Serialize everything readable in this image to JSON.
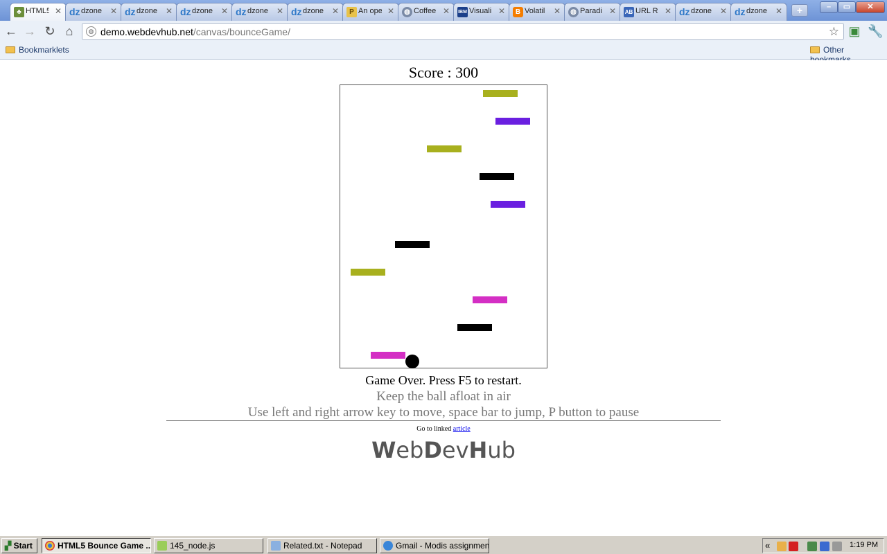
{
  "window": {
    "tabs": [
      {
        "label": "HTML5",
        "icon": "tree-icon",
        "active": true
      },
      {
        "label": "dzone",
        "icon": "dzone-icon"
      },
      {
        "label": "dzone",
        "icon": "dzone-icon"
      },
      {
        "label": "dzone",
        "icon": "dzone-icon"
      },
      {
        "label": "dzone",
        "icon": "dzone-icon"
      },
      {
        "label": "dzone",
        "icon": "dzone-icon"
      },
      {
        "label": "An ope",
        "icon": "p-icon"
      },
      {
        "label": "Coffee",
        "icon": "globe-icon"
      },
      {
        "label": "Visuali",
        "icon": "ibm-icon"
      },
      {
        "label": "Volatil",
        "icon": "blogger-icon"
      },
      {
        "label": "Paradi",
        "icon": "globe-icon"
      },
      {
        "label": "URL R",
        "icon": "ab-icon"
      },
      {
        "label": "dzone",
        "icon": "dzone-icon"
      },
      {
        "label": "dzone",
        "icon": "dzone-icon"
      }
    ],
    "new_tab_label": "+"
  },
  "toolbar": {
    "url_host": "demo.webdevhub.net",
    "url_path": "/canvas/bounceGame/"
  },
  "bookmarks": {
    "left": "Bookmarklets",
    "right": "Other bookmarks"
  },
  "game": {
    "score_text": "Score : 300",
    "status": "Game Over. Press F5 to restart.",
    "hint1": "Keep the ball afloat in air",
    "hint2": "Use left and right arrow key to move, space bar to jump, P button to pause",
    "linked_prefix": "Go to linked ",
    "linked_link": "article",
    "logo_parts": [
      {
        "t": "W",
        "b": true
      },
      {
        "t": "eb",
        "b": false
      },
      {
        "t": "D",
        "b": true
      },
      {
        "t": "ev",
        "b": false
      },
      {
        "t": "H",
        "b": true
      },
      {
        "t": "ub",
        "b": false
      }
    ],
    "colors": {
      "olive": "#a8b01e",
      "violet": "#6a1fe0",
      "black": "#000000",
      "magenta": "#d42fc4"
    },
    "platforms": [
      {
        "color": "olive"
      },
      {
        "color": "violet"
      },
      {
        "color": "olive"
      },
      {
        "color": "black"
      },
      {
        "color": "violet"
      },
      {
        "color": "black"
      },
      {
        "color": "olive"
      },
      {
        "color": "magenta"
      },
      {
        "color": "black"
      },
      {
        "color": "magenta"
      }
    ]
  },
  "taskbar": {
    "start_label": "Start",
    "tasks": [
      {
        "label": "HTML5 Bounce Game ...",
        "icon": "chrome-icon",
        "active": true
      },
      {
        "label": "145_node.js",
        "icon": "notepad-plus-icon"
      },
      {
        "label": "Related.txt - Notepad",
        "icon": "notepad-icon"
      },
      {
        "label": "Gmail - Modis assignment...",
        "icon": "ie-icon"
      }
    ],
    "clock": "1:19 PM"
  }
}
